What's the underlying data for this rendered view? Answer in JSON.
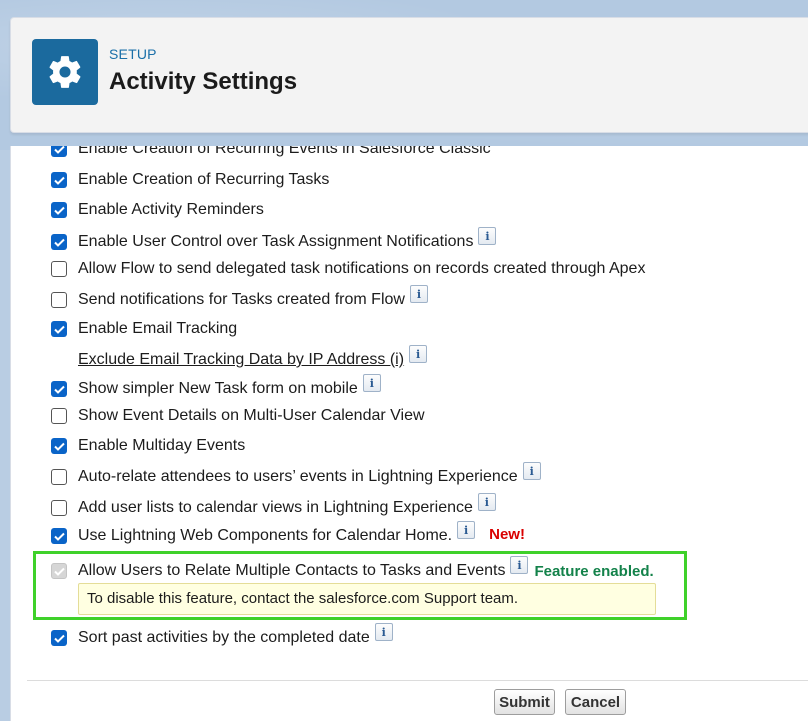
{
  "header": {
    "eyebrow": "SETUP",
    "title": "Activity Settings",
    "icon": "gear-icon"
  },
  "settings": [
    {
      "label": "Enable Creation of Recurring Events in Salesforce Classic",
      "checked": true,
      "info": false
    },
    {
      "label": "Enable Creation of Recurring Tasks",
      "checked": true,
      "info": false
    },
    {
      "label": "Enable Activity Reminders",
      "checked": true,
      "info": false
    },
    {
      "label": "Enable User Control over Task Assignment Notifications",
      "checked": true,
      "info": true
    },
    {
      "label": "Allow Flow to send delegated task notifications on records created through Apex",
      "checked": false,
      "info": false
    },
    {
      "label": "Send notifications for Tasks created from Flow",
      "checked": false,
      "info": true
    },
    {
      "label": "Enable Email Tracking",
      "checked": true,
      "info": false
    },
    {
      "label": "Exclude Email Tracking Data by IP Address (i)",
      "link": true,
      "info": true
    },
    {
      "label": "Show simpler New Task form on mobile",
      "checked": true,
      "info": true
    },
    {
      "label": "Show Event Details on Multi-User Calendar View",
      "checked": false,
      "info": false
    },
    {
      "label": "Enable Multiday Events",
      "checked": true,
      "info": false
    },
    {
      "label": "Auto-relate attendees to users’ events in Lightning Experience",
      "checked": false,
      "info": true
    },
    {
      "label": "Add user lists to calendar views in Lightning Experience",
      "checked": false,
      "info": true
    },
    {
      "label": "Use Lightning Web Components for Calendar Home.",
      "checked": true,
      "info": true,
      "badge": "New!"
    },
    {
      "label": "Allow Users to Relate Multiple Contacts to Tasks and Events",
      "checked": true,
      "disabled": true,
      "info": true,
      "status": "Feature enabled."
    },
    {
      "label": "Sort past activities by the completed date",
      "checked": true,
      "info": true
    }
  ],
  "info_glyph": "i",
  "disable_note": "To disable this feature, contact the salesforce.com Support team.",
  "buttons": {
    "submit": "Submit",
    "cancel": "Cancel"
  },
  "colors": {
    "accent": "#0a64c8",
    "header_icon_bg": "#1b6a9e",
    "highlight": "#3fd12a",
    "new_badge": "#d90000",
    "enabled_status": "#13824a"
  }
}
